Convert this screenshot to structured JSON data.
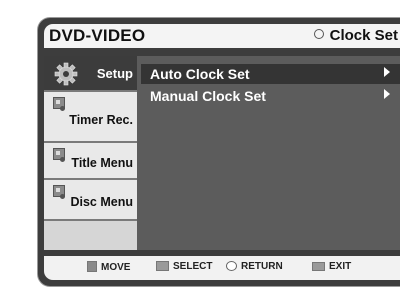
{
  "header": {
    "title": "DVD-VIDEO",
    "section": "Clock Set"
  },
  "sidebar": {
    "items": [
      {
        "label": "Setup",
        "icon": "gear-icon",
        "active": true
      },
      {
        "label": "Timer Rec.",
        "icon": "timer-icon",
        "active": false
      },
      {
        "label": "Title Menu",
        "icon": "title-icon",
        "active": false
      },
      {
        "label": "Disc Menu",
        "icon": "disc-icon",
        "active": false
      }
    ]
  },
  "menu": {
    "items": [
      {
        "label": "Auto Clock Set",
        "highlighted": true
      },
      {
        "label": "Manual Clock Set",
        "highlighted": false
      }
    ]
  },
  "footer": {
    "move": "MOVE",
    "select": "SELECT",
    "return": "RETURN",
    "exit": "EXIT"
  },
  "colors": {
    "panel": "#3d3d3d",
    "content": "#5c5c5c",
    "highlight": "#343434",
    "header": "#f4f4f4"
  }
}
